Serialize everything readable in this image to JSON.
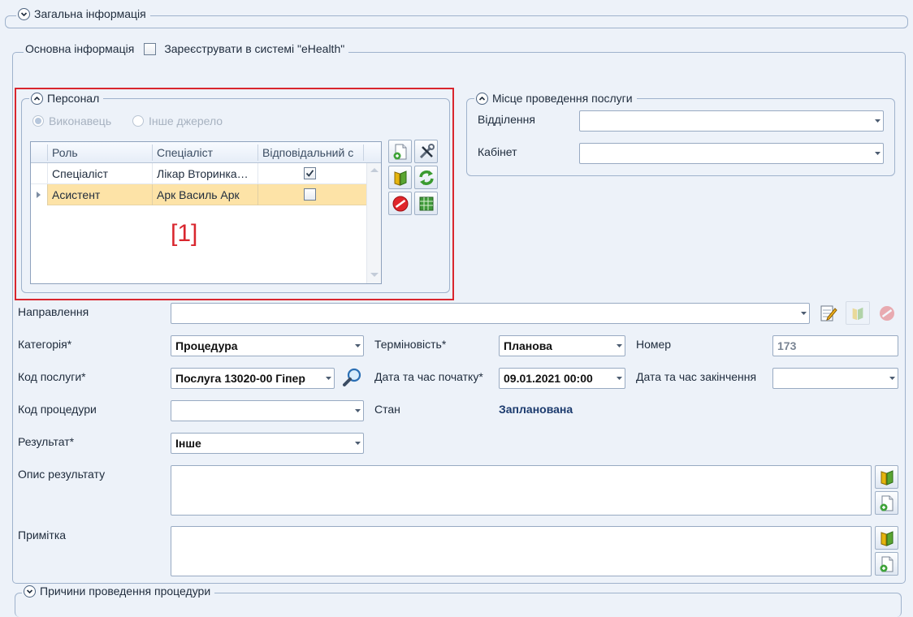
{
  "sections": {
    "general_info": "Загальна інформація",
    "procedure_reasons": "Причини проведення процедури"
  },
  "tabs": {
    "main_info": "Основна інформація",
    "ehealth_register": "Зареєструвати в системі \"eHealth\""
  },
  "personnel": {
    "title": "Персонал",
    "radio_executor": "Виконавець",
    "radio_other_source": "Інше джерело",
    "columns": [
      "Роль",
      "Спеціаліст",
      "Відповідальний с"
    ],
    "rows": [
      {
        "role": "Спеціаліст",
        "specialist": "Лікар Вторинка…",
        "responsible": true
      },
      {
        "role": "Асистент",
        "specialist": "Арк Василь Арк",
        "responsible": false
      }
    ],
    "annotation": "[1]"
  },
  "location": {
    "title": "Місце проведення послуги",
    "department_label": "Відділення",
    "department_value": "",
    "cabinet_label": "Кабінет",
    "cabinet_value": ""
  },
  "form": {
    "referral_label": "Направлення",
    "referral_value": "",
    "category_label": "Категорія*",
    "category_value": "Процедура",
    "urgency_label": "Терміновість*",
    "urgency_value": "Планова",
    "number_label": "Номер",
    "number_value": "173",
    "service_code_label": "Код послуги*",
    "service_code_value": "Послуга 13020-00 Гіпер",
    "start_label": "Дата та час початку*",
    "start_value": "09.01.2021 00:00",
    "end_label": "Дата та час закінчення",
    "end_value": "",
    "procedure_code_label": "Код процедури",
    "procedure_code_value": "",
    "state_label": "Стан",
    "state_value": "Запланована",
    "result_label": "Результат*",
    "result_value": "Інше",
    "result_desc_label": "Опис результату",
    "note_label": "Примітка"
  },
  "colors": {
    "background": "#edf2f9",
    "selected_row": "#fde3a7",
    "annotation_red": "#d9262e",
    "state_text": "#1c3b6e"
  }
}
